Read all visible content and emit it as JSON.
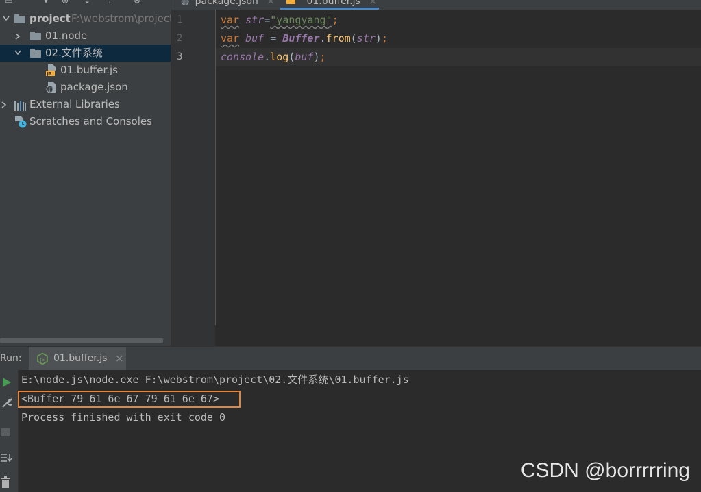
{
  "project": {
    "tree": [
      {
        "label": "project",
        "hint": "F:\\webstrom\\project",
        "type": "root"
      },
      {
        "label": "01.node",
        "type": "folder"
      },
      {
        "label": "02.文件系统",
        "type": "folder",
        "selected": true
      },
      {
        "label": "01.buffer.js",
        "type": "js"
      },
      {
        "label": "package.json",
        "type": "json"
      },
      {
        "label": "External Libraries",
        "type": "libraries"
      },
      {
        "label": "Scratches and Consoles",
        "type": "scratches"
      }
    ]
  },
  "tabs": [
    {
      "label": "package.json"
    },
    {
      "label": "01.buffer.js",
      "active": true
    }
  ],
  "editor": {
    "line_numbers": [
      "1",
      "2",
      "3"
    ],
    "line1": {
      "kw": "var",
      "var": "str",
      "eq": "=",
      "str": "\"yangyang\"",
      "semi": ";"
    },
    "line2": {
      "kw": "var",
      "var": "buf",
      "eq": " = ",
      "cls": "Buffer",
      "dot": ".",
      "fn": "from",
      "lp": "(",
      "arg": "str",
      "rp": ")",
      "semi": ";"
    },
    "line3": {
      "obj": "console",
      "dot": ".",
      "fn": "log",
      "lp": "(",
      "arg": "buf",
      "rp": ")",
      "semi": ";"
    }
  },
  "run": {
    "title": "Run:",
    "tab_label": "01.buffer.js",
    "close": "×",
    "lines": [
      "E:\\node.js\\node.exe F:\\webstrom\\project\\02.文件系统\\01.buffer.js",
      "<Buffer 79 61 6e 67 79 61 6e 67>",
      "Process finished with exit code 0"
    ]
  },
  "watermark": "CSDN @borrrrring",
  "colors": {
    "accent": "#4a88c7",
    "highlight_box": "#e8833a",
    "run_green": "#499c54"
  }
}
